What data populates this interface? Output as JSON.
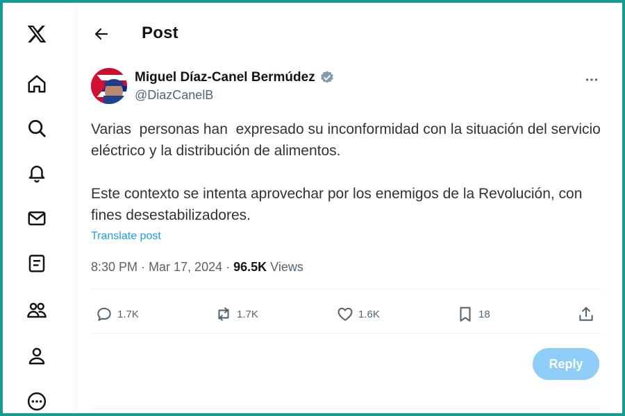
{
  "header": {
    "title": "Post"
  },
  "sidebar": {
    "items": [
      {
        "icon": "x-logo-icon"
      },
      {
        "icon": "home-icon"
      },
      {
        "icon": "search-icon"
      },
      {
        "icon": "bell-icon"
      },
      {
        "icon": "mail-icon"
      },
      {
        "icon": "lists-icon"
      },
      {
        "icon": "communities-icon"
      },
      {
        "icon": "profile-icon"
      },
      {
        "icon": "more-circle-icon"
      }
    ]
  },
  "post": {
    "author_name": "Miguel Díaz-Canel Bermúdez",
    "handle": "@DiazCanelB",
    "verified": true,
    "paragraphs": [
      "Varias  personas han  expresado su inconformidad con la situación del servicio eléctrico y la distribución de alimentos.",
      "Este contexto se intenta aprovechar por los enemigos de la Revolución, con fines desestabilizadores."
    ],
    "translate_label": "Translate post",
    "time": "8:30 PM · Mar 17, 2024 · ",
    "views_count": "96.5K",
    "views_label": " Views",
    "stats": {
      "replies": "1.7K",
      "reposts": "1.7K",
      "likes": "1.6K",
      "bookmarks": "18"
    }
  },
  "reply_button": "Reply",
  "colors": {
    "accent": "#1d9bf0",
    "reply_disabled": "#8ecdf7",
    "frame": "#149c90",
    "secondary_text": "#536471"
  }
}
